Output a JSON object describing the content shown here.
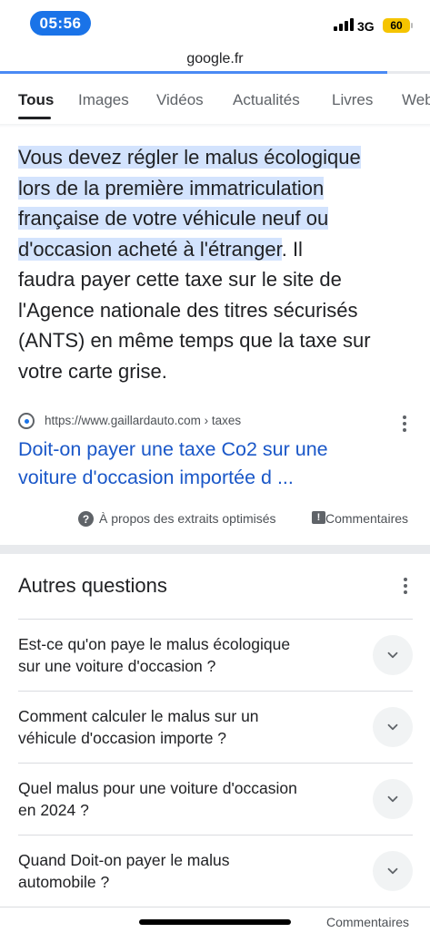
{
  "status": {
    "time": "05:56",
    "network": "3G",
    "battery": "60",
    "time_color": "#1a73e8",
    "battery_color": "#f5c400"
  },
  "browser": {
    "url": "google.fr",
    "load_progress": 0.9
  },
  "tabs": [
    {
      "label": "Tous",
      "active": true
    },
    {
      "label": "Images"
    },
    {
      "label": "Vidéos"
    },
    {
      "label": "Actualités"
    },
    {
      "label": "Livres"
    },
    {
      "label": "Web"
    }
  ],
  "snippet": {
    "highlight_l1": "Vous devez régler le malus écologique",
    "highlight_l2": "lors de la première immatriculation",
    "highlight_l3": "française de votre véhicule neuf ou",
    "highlight_l4": "d'occasion acheté à l'étranger",
    "rest_l4": ". Il",
    "rest_l5": "faudra payer cette taxe sur le site de",
    "rest_l6": "l'Agence nationale des titres sécurisés",
    "rest_l7": "(ANTS) en même temps que la taxe sur",
    "rest_l8": "votre carte grise.",
    "source_url": "https://www.gaillardauto.com › taxes",
    "link_l1": "Doit-on payer une taxe Co2 sur une",
    "link_l2": "voiture d'occasion importée d ...",
    "about_label": "À propos des extraits optimisés",
    "feedback_label": "Commentaires",
    "highlight_color": "#d3e3fd",
    "link_color": "#1a57c8"
  },
  "paa": {
    "title": "Autres questions",
    "questions": [
      {
        "l1": "Est-ce qu'on paye le malus écologique",
        "l2": "sur une voiture d'occasion ?"
      },
      {
        "l1": "Comment calculer le malus sur un",
        "l2": "véhicule d'occasion importe ?"
      },
      {
        "l1": "Quel malus pour une voiture d'occasion",
        "l2": "en 2024 ?"
      },
      {
        "l1": "Quand Doit-on payer le malus",
        "l2": "automobile ?"
      }
    ]
  },
  "bottom": {
    "feedback_label": "Commentaires"
  }
}
